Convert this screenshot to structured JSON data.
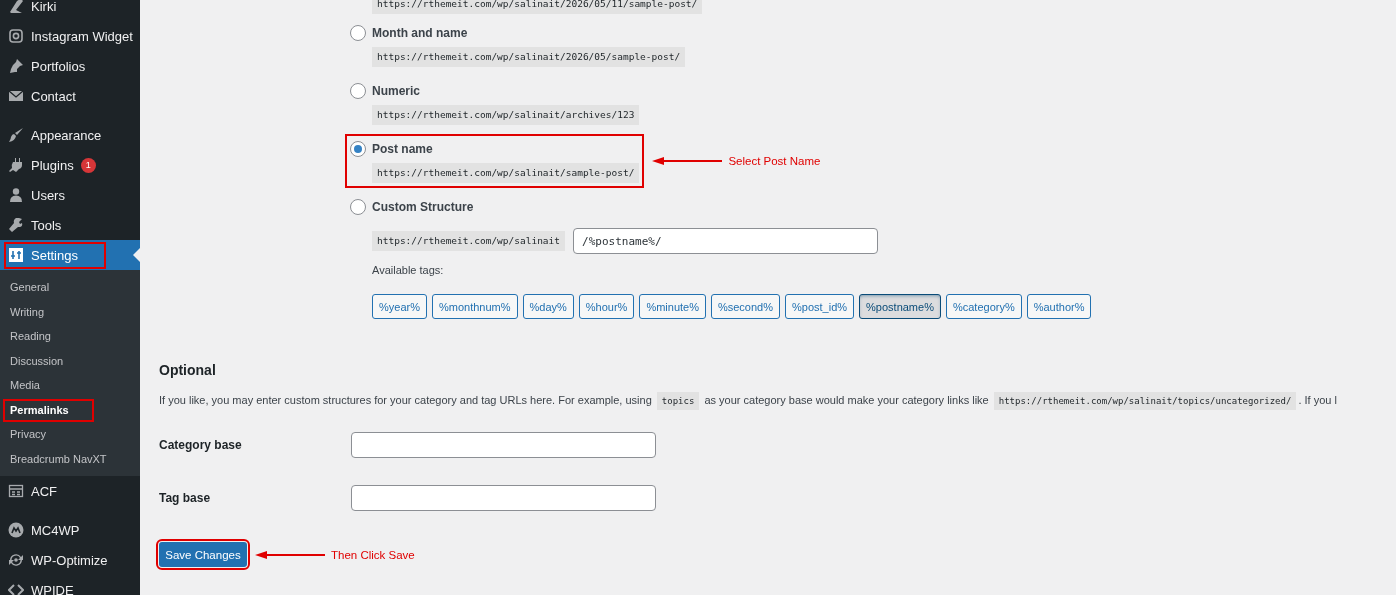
{
  "sidebar": {
    "groups": [
      {
        "items": [
          {
            "label": "Kirki",
            "selected": false,
            "marked": false
          },
          {
            "label": "Instagram Widget",
            "selected": false,
            "marked": false
          },
          {
            "label": "Portfolios",
            "selected": false,
            "marked": false
          },
          {
            "label": "Contact",
            "selected": false,
            "marked": false
          }
        ]
      },
      {
        "items": [
          {
            "label": "Appearance",
            "selected": false,
            "marked": false
          },
          {
            "label": "Plugins",
            "badge": "1",
            "selected": false,
            "marked": false
          },
          {
            "label": "Users",
            "selected": false,
            "marked": false
          },
          {
            "label": "Tools",
            "selected": false,
            "marked": false
          },
          {
            "label": "Settings",
            "selected": true,
            "marked": true,
            "submenu": [
              {
                "label": "General",
                "selected": false,
                "marked": false
              },
              {
                "label": "Writing",
                "selected": false,
                "marked": false
              },
              {
                "label": "Reading",
                "selected": false,
                "marked": false
              },
              {
                "label": "Discussion",
                "selected": false,
                "marked": false
              },
              {
                "label": "Media",
                "selected": false,
                "marked": false
              },
              {
                "label": "Permalinks",
                "selected": true,
                "marked": true
              },
              {
                "label": "Privacy",
                "selected": false,
                "marked": false
              },
              {
                "label": "Breadcrumb NavXT",
                "selected": false,
                "marked": false
              }
            ]
          },
          {
            "label": "ACF",
            "selected": false,
            "marked": false
          }
        ]
      },
      {
        "items": [
          {
            "label": "MC4WP",
            "selected": false,
            "marked": false
          },
          {
            "label": "WP-Optimize",
            "selected": false,
            "marked": false
          },
          {
            "label": "WPIDE",
            "selected": false,
            "marked": false
          }
        ]
      }
    ]
  },
  "permalinks": {
    "cut_example": "https://rthemeit.com/wp/salinait/2026/05/11/sample-post/",
    "options": [
      {
        "kind": "example",
        "label": "Month and name",
        "example": "https://rthemeit.com/wp/salinait/2026/05/sample-post/",
        "selected": false,
        "marked": false
      },
      {
        "kind": "example",
        "label": "Numeric",
        "example": "https://rthemeit.com/wp/salinait/archives/123",
        "selected": false,
        "marked": false
      },
      {
        "kind": "example",
        "label": "Post name",
        "example": "https://rthemeit.com/wp/salinait/sample-post/",
        "selected": true,
        "marked": true,
        "annotation": "Select Post Name"
      },
      {
        "kind": "custom",
        "label": "Custom Structure",
        "prefix": "https://rthemeit.com/wp/salinait",
        "value": "/%postname%/",
        "selected": false,
        "marked": false,
        "tags_label": "Available tags:",
        "tags": [
          {
            "label": "%year%",
            "selected": false
          },
          {
            "label": "%monthnum%",
            "selected": false
          },
          {
            "label": "%day%",
            "selected": false
          },
          {
            "label": "%hour%",
            "selected": false
          },
          {
            "label": "%minute%",
            "selected": false
          },
          {
            "label": "%second%",
            "selected": false
          },
          {
            "label": "%post_id%",
            "selected": false
          },
          {
            "label": "%postname%",
            "selected": true
          },
          {
            "label": "%category%",
            "selected": false
          },
          {
            "label": "%author%",
            "selected": false
          }
        ]
      }
    ]
  },
  "optional": {
    "heading": "Optional",
    "description": [
      {
        "kind": "text",
        "text": "If you like, you may enter custom structures for your category and tag URLs here. For example, using "
      },
      {
        "kind": "code",
        "text": "topics"
      },
      {
        "kind": "text",
        "text": " as your category base would make your category links like "
      },
      {
        "kind": "code",
        "text": "https://rthemeit.com/wp/salinait/topics/uncategorized/"
      },
      {
        "kind": "text",
        "text": ". If you l"
      }
    ],
    "fields": [
      {
        "label": "Category base"
      },
      {
        "label": "Tag base"
      }
    ]
  },
  "save_button": {
    "label": "Save Changes",
    "marked": true,
    "annotation": "Then Click Save"
  }
}
